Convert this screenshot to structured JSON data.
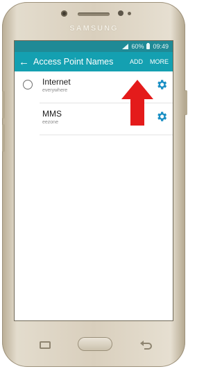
{
  "device": {
    "brand": "SAMSUNG"
  },
  "status_bar": {
    "battery": "60%",
    "time": "09:49"
  },
  "app_bar": {
    "title": "Access Point Names",
    "add_label": "ADD",
    "more_label": "MORE"
  },
  "apns": [
    {
      "name": "Internet",
      "apn": "everywhere"
    },
    {
      "name": "MMS",
      "apn": "eezone"
    }
  ],
  "colors": {
    "status_bar": "#1f8a96",
    "app_bar": "#14a0b1",
    "accent": "#1a8fc4",
    "annotation_arrow": "#e41b1b"
  },
  "icons": [
    "back-arrow-icon",
    "settings-gear-icon",
    "radio-button-icon",
    "annotation-arrow-icon"
  ]
}
